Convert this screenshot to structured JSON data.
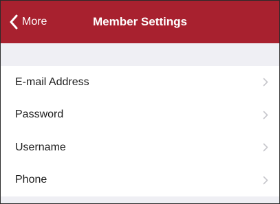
{
  "nav": {
    "back_label": "More",
    "title": "Member Settings",
    "background_color": "#a8212f",
    "back_icon": "chevron-left-icon"
  },
  "settings": {
    "items": [
      {
        "label": "E-mail Address",
        "icon": "chevron-right-icon"
      },
      {
        "label": "Password",
        "icon": "chevron-right-icon"
      },
      {
        "label": "Username",
        "icon": "chevron-right-icon"
      },
      {
        "label": "Phone",
        "icon": "chevron-right-icon"
      }
    ]
  }
}
